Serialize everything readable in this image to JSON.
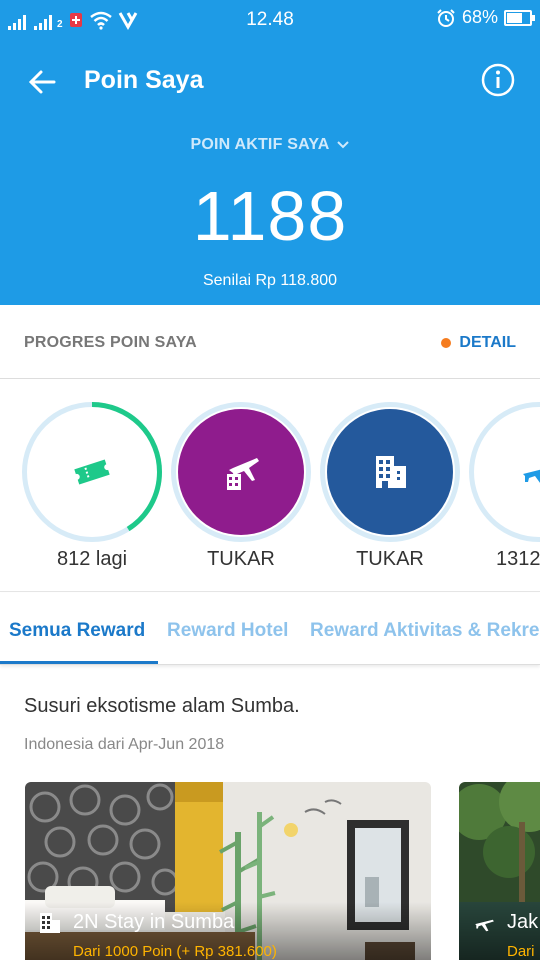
{
  "status_bar": {
    "carrier_label": "2",
    "time": "12.48",
    "battery": "68%",
    "battery_level": 0.68
  },
  "header": {
    "title": "Poin Saya",
    "points_label": "POIN AKTIF SAYA",
    "points_value": "1188",
    "points_worth": "Senilai Rp 118.800",
    "bg_color": "#1e9be6"
  },
  "progress": {
    "title": "PROGRES POIN SAYA",
    "detail_label": "DETAIL"
  },
  "rewards": [
    {
      "label": "812 lagi",
      "icon": "ticket-icon",
      "color": "#1ec98a",
      "progress": 0.41
    },
    {
      "label": "TUKAR",
      "icon": "flight-hotel-icon",
      "color": "#8f1c8d"
    },
    {
      "label": "TUKAR",
      "icon": "hotel-building-icon",
      "color": "#24599c"
    },
    {
      "label": "1312",
      "icon": "airplane-icon",
      "color": "#1e9be6"
    }
  ],
  "tabs": [
    {
      "label": "Semua Reward",
      "active": true
    },
    {
      "label": "Reward Hotel",
      "active": false
    },
    {
      "label": "Reward Aktivitas & Rekre",
      "active": false
    }
  ],
  "promo": {
    "title": "Susuri eksotisme alam Sumba.",
    "subtitle": "Indonesia dari Apr-Jun 2018",
    "cards": [
      {
        "title": "2N Stay in Sumba",
        "subtitle": "Dari 1000 Poin (+ Rp 381.600)",
        "icon": "hotel-icon"
      },
      {
        "title": "Jak",
        "subtitle": "Dari",
        "icon": "airplane-icon"
      }
    ]
  }
}
